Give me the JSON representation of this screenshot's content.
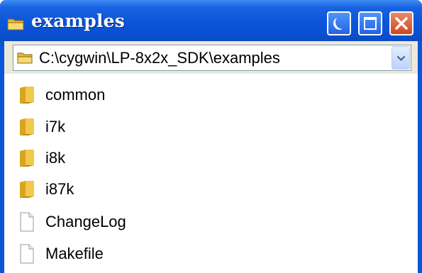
{
  "window": {
    "title": "examples",
    "title_icon": "folder-icon",
    "controls": [
      {
        "name": "minimize",
        "icon": "minimize-icon"
      },
      {
        "name": "maximize",
        "icon": "maximize-icon"
      },
      {
        "name": "close",
        "icon": "close-icon"
      }
    ]
  },
  "address": {
    "path": "C:\\cygwin\\LP-8x2x_SDK\\examples",
    "icon": "folder-icon",
    "dropdown_icon": "chevron-down-icon"
  },
  "items": [
    {
      "label": "common",
      "type": "folder"
    },
    {
      "label": "i7k",
      "type": "folder"
    },
    {
      "label": "i8k",
      "type": "folder"
    },
    {
      "label": "i87k",
      "type": "folder"
    },
    {
      "label": "ChangeLog",
      "type": "file"
    },
    {
      "label": "Makefile",
      "type": "file"
    }
  ],
  "colors": {
    "titlebar": "#0b55da",
    "close_button": "#d2461e",
    "folder": "#f0c64a",
    "toolbar_bg": "#ece9d8"
  }
}
